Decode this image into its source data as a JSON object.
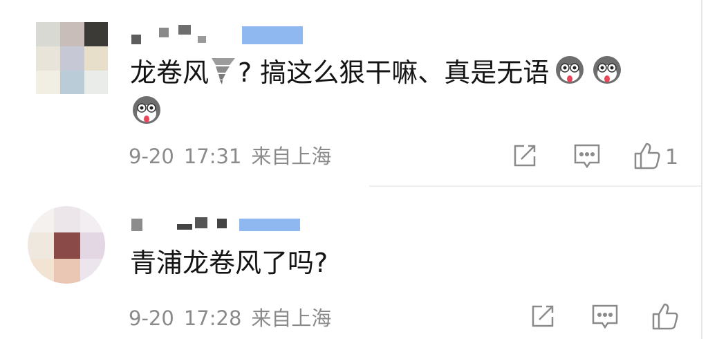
{
  "comments": [
    {
      "text_prefix": "龙卷风",
      "text_body": "? 搞这么狠干嘛、真是无语",
      "date": "9-20",
      "time": "17:31",
      "location": "来自上海",
      "like_count": "1"
    },
    {
      "text_body": "青浦龙卷风了吗?",
      "date": "9-20",
      "time": "17:28",
      "location": "来自上海",
      "like_count": ""
    }
  ],
  "icons": {
    "tornado": "tornado-emoji",
    "husky": "husky-emoji",
    "share": "share-icon",
    "reply": "comment-icon",
    "like": "thumbs-up-icon"
  },
  "colors": {
    "text": "#141414",
    "meta": "#8a8a8a",
    "name_highlight": "#8fb8f0"
  }
}
